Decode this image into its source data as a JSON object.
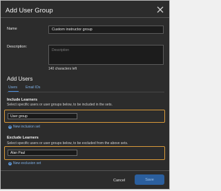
{
  "dialog": {
    "title": "Add User Group"
  },
  "form": {
    "name_label": "Name",
    "name_value": "Custom instructor group",
    "description_label": "Description:",
    "description_placeholder": "Description",
    "chars_left": "140 characters left"
  },
  "add_users": {
    "title": "Add Users",
    "tabs": [
      {
        "label": "Users",
        "active": true
      },
      {
        "label": "Email IDs",
        "active": false
      }
    ]
  },
  "include": {
    "title": "Include Learners",
    "description": "Select specific users or user groups below, to be included in the sets.",
    "value": "User group",
    "new_set": "New inclusion set"
  },
  "exclude": {
    "title": "Exclude Learners",
    "description": "Select specific users or user groups below, to be excluded from the above sets.",
    "value": "Alan Paul",
    "new_set": "New exclusion set"
  },
  "footer": {
    "cancel": "Cancel",
    "save": "Save"
  },
  "colors": {
    "highlight": "#d99a3a",
    "link": "#7fb0e6",
    "primary": "#2b5f9e"
  }
}
